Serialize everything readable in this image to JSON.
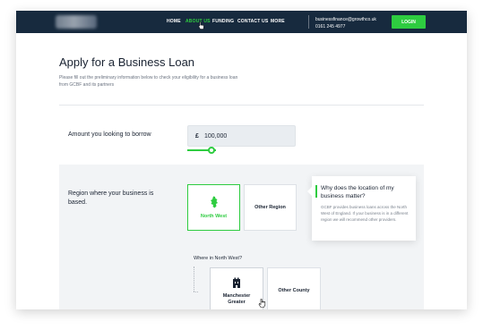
{
  "nav": {
    "links": [
      "HOME",
      "ABOUT US",
      "FUNDING",
      "CONTACT US",
      "MORE"
    ],
    "email": "businessfinance@growthco.uk",
    "phone": "0161 245 4977",
    "login_label": "LOGIN"
  },
  "page": {
    "title": "Apply for a Business Loan",
    "subtitle": "Please fill out the preliminary information below to check your eligibility for a business loan from GCBF and its partners"
  },
  "amount": {
    "label": "Amount you looking to borrow",
    "currency": "£",
    "value": "100,000"
  },
  "region": {
    "label": "Region where your business is based.",
    "options": [
      "North West",
      "Other Region"
    ],
    "selected": "North West",
    "tooltip_title": "Why does the location of my business matter?",
    "tooltip_body": "GCBF provides business loans across the North West of England. If your business is in a different region we will recommend other providers.",
    "sub_question": "Where in North West?",
    "sub_options": [
      "Manchester Greater",
      "Other County"
    ]
  },
  "colors": {
    "accent": "#2ecc40",
    "navbar": "#172a3e",
    "text": "#1a2332"
  },
  "icons": [
    "cursor-pointer-icon",
    "north-west-map-icon",
    "manchester-building-icon",
    "cursor-hand-icon"
  ]
}
